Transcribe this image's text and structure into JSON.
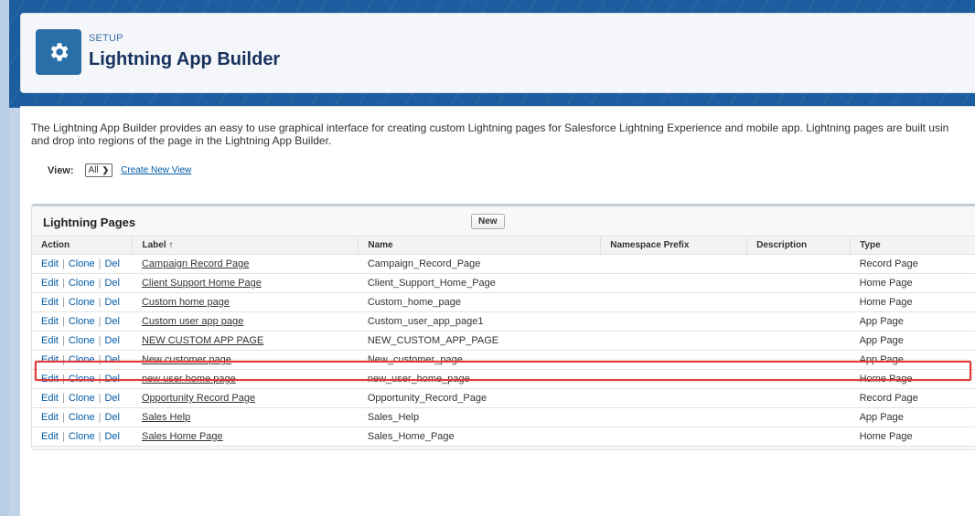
{
  "header": {
    "section": "SETUP",
    "title": "Lightning App Builder",
    "icon": "gear-icon"
  },
  "intro": {
    "line1": "The Lightning App Builder provides an easy to use graphical interface for creating custom Lightning pages for Salesforce Lightning Experience and mobile app. Lightning pages are built usin",
    "line2": "and drop into regions of the page in the Lightning App Builder."
  },
  "view": {
    "label": "View:",
    "selected": "All",
    "create_link": "Create New View"
  },
  "list": {
    "title": "Lightning Pages",
    "new_button": "New",
    "columns": [
      "Action",
      "Label ↑",
      "Name",
      "Namespace Prefix",
      "Description",
      "Type"
    ],
    "action_labels": {
      "edit": "Edit",
      "clone": "Clone",
      "del": "Del",
      "sep": "|"
    },
    "rows": [
      {
        "label": "Campaign Record Page",
        "name": "Campaign_Record_Page",
        "namespace": "",
        "description": "",
        "type": "Record Page",
        "highlighted": true
      },
      {
        "label": "Client Support Home Page",
        "name": "Client_Support_Home_Page",
        "namespace": "",
        "description": "",
        "type": "Home Page"
      },
      {
        "label": "Custom home page",
        "name": "Custom_home_page",
        "namespace": "",
        "description": "",
        "type": "Home Page"
      },
      {
        "label": "Custom user app page",
        "name": "Custom_user_app_page1",
        "namespace": "",
        "description": "",
        "type": "App Page"
      },
      {
        "label": "NEW CUSTOM APP PAGE",
        "name": "NEW_CUSTOM_APP_PAGE",
        "namespace": "",
        "description": "",
        "type": "App Page"
      },
      {
        "label": "New customer page",
        "name": "New_customer_page",
        "namespace": "",
        "description": "",
        "type": "App Page"
      },
      {
        "label": "new user home page",
        "name": "new_user_home_page",
        "namespace": "",
        "description": "",
        "type": "Home Page"
      },
      {
        "label": "Opportunity Record Page",
        "name": "Opportunity_Record_Page",
        "namespace": "",
        "description": "",
        "type": "Record Page"
      },
      {
        "label": "Sales Help",
        "name": "Sales_Help",
        "namespace": "",
        "description": "",
        "type": "App Page"
      },
      {
        "label": "Sales Home Page",
        "name": "Sales_Home_Page",
        "namespace": "",
        "description": "",
        "type": "Home Page"
      }
    ]
  },
  "colors": {
    "brand_band": "#1b5d9e",
    "icon_bg": "#2a6fa8",
    "link": "#015ba7",
    "highlight": "#e03a3a"
  }
}
